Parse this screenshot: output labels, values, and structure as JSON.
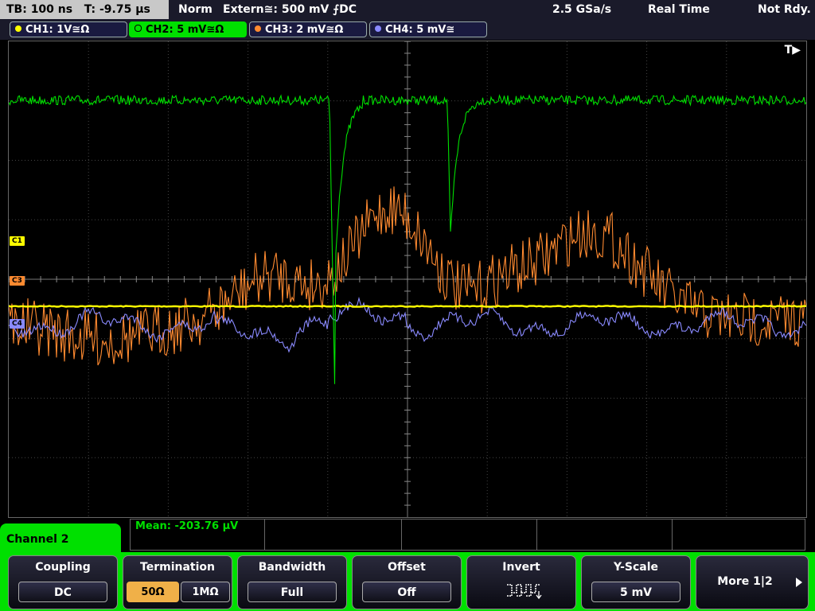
{
  "top_bar": {
    "timebase": "TB: 100 ns",
    "time_offset": "T: -9.75 µs",
    "trigger_mode": "Norm",
    "trigger_source": "Extern≅: 500 mV ⨍DC",
    "sample_rate": "2.5 GSa/s",
    "acquisition_mode": "Real Time",
    "status": "Not Rdy."
  },
  "channels": [
    {
      "label": "CH1: 1V≅Ω",
      "color": "#ffff00"
    },
    {
      "label": "CH2: 5 mV≅Ω",
      "color": "#00e000"
    },
    {
      "label": "CH3: 2 mV≅Ω",
      "color": "#ff8a30"
    },
    {
      "label": "CH4: 5 mV≅",
      "color": "#8a8aff"
    }
  ],
  "screen_markers": {
    "c1": "C1",
    "c3": "C3",
    "c4": "C4",
    "trigger_position": "T▶"
  },
  "measurement": {
    "text": "Mean: -203.76 µV"
  },
  "menu_tab": "Channel 2",
  "softkeys": {
    "coupling": {
      "label": "Coupling",
      "value": "DC"
    },
    "termination": {
      "label": "Termination",
      "option_a": "50Ω",
      "option_b": "1MΩ",
      "selected": "50Ω"
    },
    "bandwidth": {
      "label": "Bandwidth",
      "value": "Full"
    },
    "offset": {
      "label": "Offset",
      "value": "Off"
    },
    "invert": {
      "label": "Invert",
      "icon": "inverted-square-wave-icon"
    },
    "yscale": {
      "label": "Y-Scale",
      "value": "5 mV"
    },
    "more": {
      "label": "More 1|2",
      "icon": "arrow-right-icon"
    }
  },
  "colors": {
    "ch1": "#ffff00",
    "ch2": "#00e000",
    "ch3": "#ff8a30",
    "ch4": "#8a8aff",
    "highlight": "#00e000",
    "termination_selected": "#f0b048"
  }
}
